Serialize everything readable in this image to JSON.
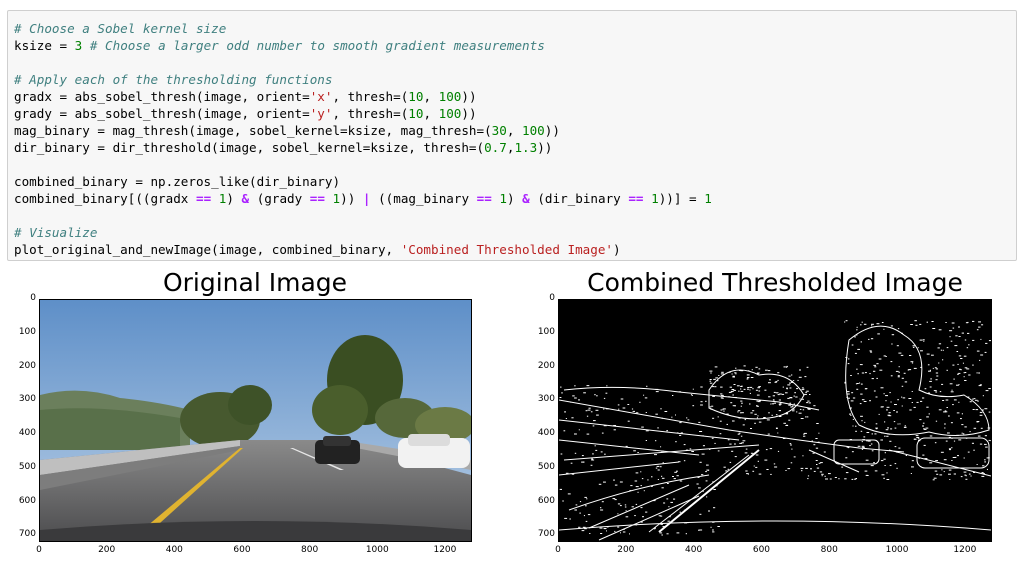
{
  "code_cell": {
    "lines": [
      [
        {
          "t": "c",
          "v": "# Choose a Sobel kernel size"
        }
      ],
      [
        {
          "t": "",
          "v": "ksize = "
        },
        {
          "t": "n",
          "v": "3"
        },
        {
          "t": "",
          "v": " "
        },
        {
          "t": "c",
          "v": "# Choose a larger odd number to smooth gradient measurements"
        }
      ],
      [
        {
          "t": "",
          "v": " "
        }
      ],
      [
        {
          "t": "c",
          "v": "# Apply each of the thresholding functions"
        }
      ],
      [
        {
          "t": "",
          "v": "gradx = abs_sobel_thresh(image, orient="
        },
        {
          "t": "s",
          "v": "'x'"
        },
        {
          "t": "",
          "v": ", thresh=("
        },
        {
          "t": "n",
          "v": "10"
        },
        {
          "t": "",
          "v": ", "
        },
        {
          "t": "n",
          "v": "100"
        },
        {
          "t": "",
          "v": "))"
        }
      ],
      [
        {
          "t": "",
          "v": "grady = abs_sobel_thresh(image, orient="
        },
        {
          "t": "s",
          "v": "'y'"
        },
        {
          "t": "",
          "v": ", thresh=("
        },
        {
          "t": "n",
          "v": "10"
        },
        {
          "t": "",
          "v": ", "
        },
        {
          "t": "n",
          "v": "100"
        },
        {
          "t": "",
          "v": "))"
        }
      ],
      [
        {
          "t": "",
          "v": "mag_binary = mag_thresh(image, sobel_kernel=ksize, mag_thresh=("
        },
        {
          "t": "n",
          "v": "30"
        },
        {
          "t": "",
          "v": ", "
        },
        {
          "t": "n",
          "v": "100"
        },
        {
          "t": "",
          "v": "))"
        }
      ],
      [
        {
          "t": "",
          "v": "dir_binary = dir_threshold(image, sobel_kernel=ksize, thresh=("
        },
        {
          "t": "n",
          "v": "0.7"
        },
        {
          "t": "",
          "v": ","
        },
        {
          "t": "n",
          "v": "1.3"
        },
        {
          "t": "",
          "v": "))"
        }
      ],
      [
        {
          "t": "",
          "v": " "
        }
      ],
      [
        {
          "t": "",
          "v": "combined_binary = np.zeros_like(dir_binary)"
        }
      ],
      [
        {
          "t": "",
          "v": "combined_binary[((gradx "
        },
        {
          "t": "o",
          "v": "=="
        },
        {
          "t": "",
          "v": " "
        },
        {
          "t": "n",
          "v": "1"
        },
        {
          "t": "",
          "v": ") "
        },
        {
          "t": "o",
          "v": "&"
        },
        {
          "t": "",
          "v": " (grady "
        },
        {
          "t": "o",
          "v": "=="
        },
        {
          "t": "",
          "v": " "
        },
        {
          "t": "n",
          "v": "1"
        },
        {
          "t": "",
          "v": ")) "
        },
        {
          "t": "o",
          "v": "|"
        },
        {
          "t": "",
          "v": " ((mag_binary "
        },
        {
          "t": "o",
          "v": "=="
        },
        {
          "t": "",
          "v": " "
        },
        {
          "t": "n",
          "v": "1"
        },
        {
          "t": "",
          "v": ") "
        },
        {
          "t": "o",
          "v": "&"
        },
        {
          "t": "",
          "v": " (dir_binary "
        },
        {
          "t": "o",
          "v": "=="
        },
        {
          "t": "",
          "v": " "
        },
        {
          "t": "n",
          "v": "1"
        },
        {
          "t": "",
          "v": "))] = "
        },
        {
          "t": "n",
          "v": "1"
        }
      ],
      [
        {
          "t": "",
          "v": " "
        }
      ],
      [
        {
          "t": "c",
          "v": "# Visualize"
        }
      ],
      [
        {
          "t": "",
          "v": "plot_original_and_newImage(image, combined_binary, "
        },
        {
          "t": "s",
          "v": "'Combined Thresholded Image'"
        },
        {
          "t": "",
          "v": ")"
        }
      ]
    ]
  },
  "colors": {
    "comment": "#408080",
    "number": "#008000",
    "string": "#ba2121",
    "operator": "#aa22ff",
    "cell_bg": "#f7f7f7",
    "cell_border": "#cfcfcf"
  },
  "plots": [
    {
      "title": "Original Image",
      "kind": "photo",
      "x_ticks": [
        "0",
        "200",
        "400",
        "600",
        "800",
        "1000",
        "1200"
      ],
      "y_ticks": [
        "0",
        "100",
        "200",
        "300",
        "400",
        "500",
        "600",
        "700"
      ],
      "xlim": [
        0,
        1280
      ],
      "ylim": [
        720,
        0
      ]
    },
    {
      "title": "Combined Thresholded Image",
      "kind": "binary",
      "x_ticks": [
        "0",
        "200",
        "400",
        "600",
        "800",
        "1000",
        "1200"
      ],
      "y_ticks": [
        "0",
        "100",
        "200",
        "300",
        "400",
        "500",
        "600",
        "700"
      ],
      "xlim": [
        0,
        1280
      ],
      "ylim": [
        720,
        0
      ]
    }
  ]
}
